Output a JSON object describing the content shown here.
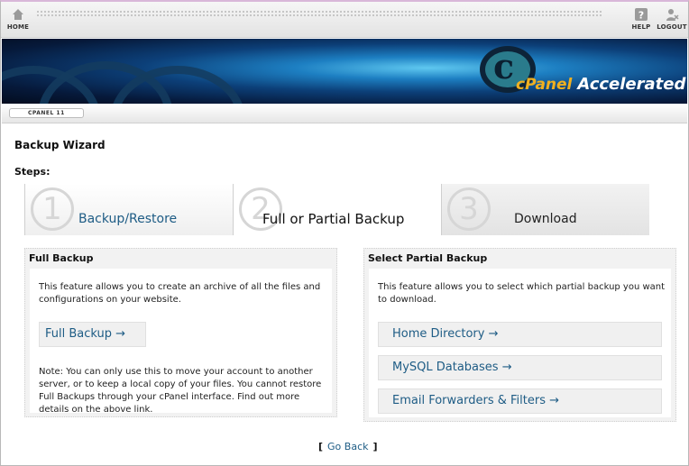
{
  "nav": {
    "home": {
      "label": "HOME",
      "icon": "home-icon"
    },
    "help": {
      "label": "HELP",
      "icon": "help-icon"
    },
    "logout": {
      "label": "LOGOUT",
      "icon": "user-icon"
    }
  },
  "banner": {
    "brand_primary": "cPanel",
    "brand_secondary": "Accelerated"
  },
  "version_tag": "CPANEL 11",
  "page_title": "Backup Wizard",
  "steps_label": "Steps:",
  "steps": [
    {
      "number": "1",
      "label": "Backup/Restore"
    },
    {
      "number": "2",
      "label": "Full or Partial Backup"
    },
    {
      "number": "3",
      "label": "Download"
    }
  ],
  "full_backup": {
    "title": "Full Backup",
    "description": "This feature allows you to create an archive of all the files and configurations on your website.",
    "button": "Full Backup →",
    "note": "Note: You can only use this to move your account to another server, or to keep a local copy of your files. You cannot restore Full Backups through your cPanel interface. Find out more details on the above link."
  },
  "partial_backup": {
    "title": "Select Partial Backup",
    "description": "This feature allows you to select which partial backup you want to download.",
    "buttons": {
      "home_directory": "Home Directory →",
      "mysql_databases": "MySQL Databases →",
      "email_forwarders": "Email Forwarders & Filters →"
    }
  },
  "go_back": {
    "open": "[",
    "label": "Go Back",
    "close": "]"
  },
  "colors": {
    "link": "#1e5c85",
    "panel_bg": "#f2f2f2",
    "brand_orange": "#f0b020"
  }
}
